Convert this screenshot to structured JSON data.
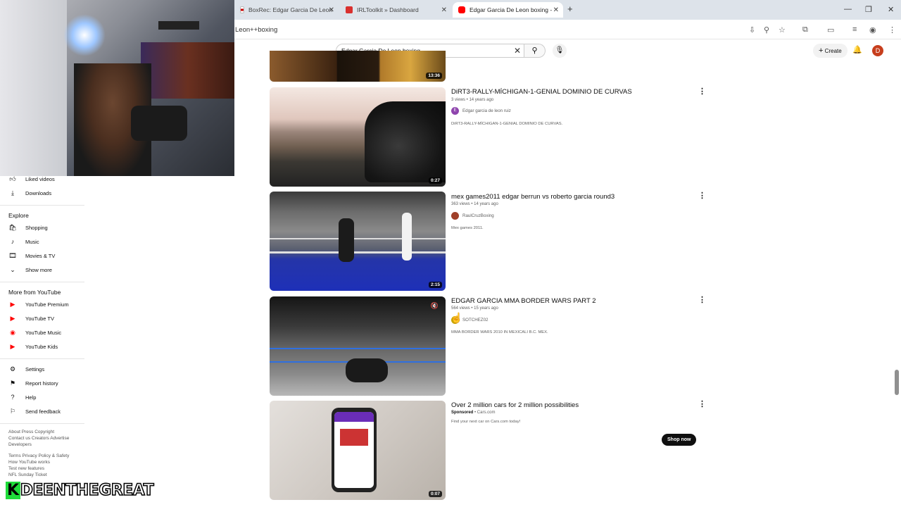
{
  "browser": {
    "tabs": [
      {
        "label": "BoxRec: Edgar Garcia De Leon",
        "color": "#ffffff"
      },
      {
        "label": "IRLToolkit » Dashboard",
        "color": "#d9302e"
      },
      {
        "label": "Edgar Garcia De Leon boxing -",
        "color": "#ff0000"
      }
    ],
    "url_fragment": "Leon++boxing"
  },
  "youtube": {
    "search_value": "Edgar Garcia De Leon  boxing",
    "create_label": "Create",
    "avatar_letter": "D"
  },
  "sidebar": {
    "top_items": [
      {
        "label": "Liked videos",
        "icon": "thumb-up-icon"
      },
      {
        "label": "Downloads",
        "icon": "download-icon"
      }
    ],
    "explore_heading": "Explore",
    "explore_items": [
      {
        "label": "Shopping",
        "icon": "shopping-bag-icon"
      },
      {
        "label": "Music",
        "icon": "music-note-icon"
      },
      {
        "label": "Movies & TV",
        "icon": "film-icon"
      },
      {
        "label": "Show more",
        "icon": "chevron-down-icon"
      }
    ],
    "more_heading": "More from YouTube",
    "more_items": [
      {
        "label": "YouTube Premium"
      },
      {
        "label": "YouTube TV"
      },
      {
        "label": "YouTube Music"
      },
      {
        "label": "YouTube Kids"
      }
    ],
    "settings_items": [
      {
        "label": "Settings",
        "icon": "gear-icon"
      },
      {
        "label": "Report history",
        "icon": "flag-icon"
      },
      {
        "label": "Help",
        "icon": "help-icon"
      },
      {
        "label": "Send feedback",
        "icon": "feedback-icon"
      }
    ],
    "footer1": "About  Press  Copyright\nContact us  Creators  Advertise\nDevelopers",
    "footer2": "Terms  Privacy  Policy & Safety\nHow YouTube works\nTest new features\nNFL Sunday Ticket"
  },
  "watermark": {
    "k": "K",
    "rest": "DEENTHEGREAT"
  },
  "results": [
    {
      "title": "",
      "meta": "",
      "channel": "",
      "desc": "",
      "duration": "13:36"
    },
    {
      "title": "DiRT3-RALLY-MÍCHIGAN-1-GENIAL DOMINIO DE CURVAS",
      "meta": "3 views • 14 years ago",
      "channel": "Edgar garcia de leon ruiz",
      "desc": "DiRT3-RALLY-MÍCHIGAN-1-GENIAL DOMINIO DE CURVAS.",
      "duration": "0:27"
    },
    {
      "title": "mex games2011 edgar berrun vs roberto garcia round3",
      "meta": "363 views • 14 years ago",
      "channel": "RaulCruzBoxing",
      "desc": "Mex games 2011.",
      "duration": "2:15"
    },
    {
      "title": "EDGAR GARCIA MMA BORDER WARS PART 2",
      "meta": "564 views • 15 years ago",
      "channel": "SOTCHEZ02",
      "desc": "MMA BORDER WARS 2010 IN MEXICALI B.C. MEX.",
      "duration": ""
    },
    {
      "title": "Over 2 million cars for 2 million possibilities",
      "meta": "Sponsored",
      "channel": "Cars.com",
      "desc": "Find your next car on Cars.com today!",
      "duration": "0:07"
    }
  ],
  "ad": {
    "cta": "Shop now"
  }
}
